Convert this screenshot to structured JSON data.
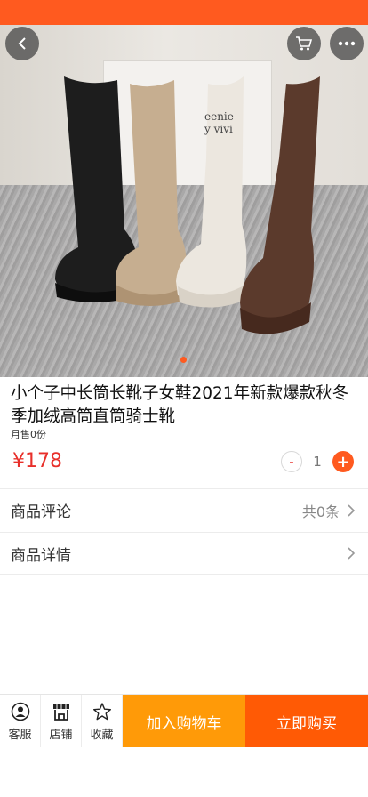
{
  "colors": {
    "accent": "#ff5a1f",
    "price": "#e8302b",
    "add_cart": "#ff9a08",
    "buy_now": "#ff5a05"
  },
  "header": {
    "back_icon": "chevron-left-icon",
    "cart_icon": "shopping-cart-icon",
    "more_icon": "more-dots-icon"
  },
  "gallery": {
    "current_index": 1,
    "bag_text": "eenie\ny vivi"
  },
  "product": {
    "title": "小个子中长筒长靴子女鞋2021年新款爆款秋冬季加绒高筒直筒骑士靴",
    "sales": "月售0份",
    "price": "¥178",
    "quantity": "1",
    "minus_label": "-",
    "plus_label": "+"
  },
  "reviews": {
    "label": "商品评论",
    "count_text": "共0条"
  },
  "details": {
    "label": "商品详情"
  },
  "bottom_bar": {
    "service_label": "客服",
    "store_label": "店铺",
    "favorite_label": "收藏",
    "add_to_cart_label": "加入购物车",
    "buy_now_label": "立即购买"
  }
}
